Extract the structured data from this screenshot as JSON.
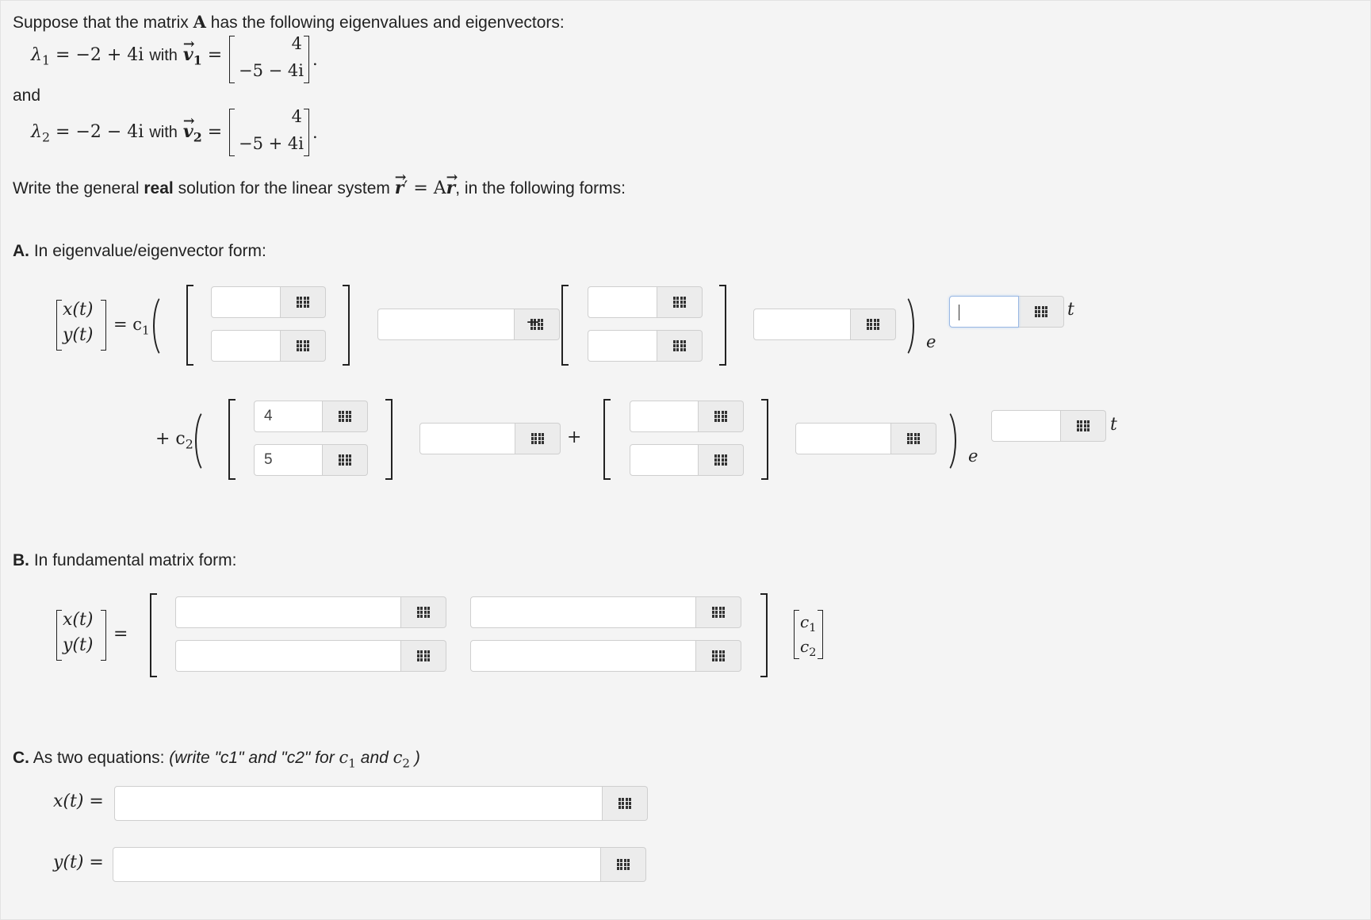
{
  "intro": {
    "line1": "Suppose that the matrix",
    "line1_sym": "A",
    "line1_rest": "has the following eigenvalues and eigenvectors:",
    "and": "and"
  },
  "eig1": {
    "lambda": "λ",
    "sub": "1",
    "value": "= −2 + 4i",
    "with": "with",
    "vec": "v",
    "eq": "=",
    "top": "4",
    "bottom": "−5 − 4i",
    "dot": "."
  },
  "eig2": {
    "lambda": "λ",
    "sub": "2",
    "value": "= −2 − 4i",
    "with": "with",
    "vec": "v",
    "eq": "=",
    "top": "4",
    "bottom": "−5 + 4i",
    "dot": "."
  },
  "instruction": {
    "pre": "Write the general",
    "bold": "real",
    "mid": "solution for the linear system",
    "eq": "′ = A",
    "r": "r",
    "post": ", in the following forms:"
  },
  "partA": {
    "label": "A.",
    "title": "In eigenvalue/eigenvector form:",
    "xt": "x(t)",
    "yt": "y(t)",
    "eq_c1": "= c",
    "c1_sub": "1",
    "plus_c2": "+ c",
    "c2_sub": "2",
    "minus": "−",
    "plus": "+",
    "e": "e",
    "t": "t",
    "row2_top_value": "4",
    "row2_bottom_value": "5"
  },
  "partB": {
    "label": "B.",
    "title": "In fundamental matrix form:",
    "xt": "x(t)",
    "yt": "y(t)",
    "eq": "=",
    "c": "c",
    "c1_sub": "1",
    "c2_sub": "2"
  },
  "partC": {
    "label": "C.",
    "title": "As two equations:",
    "hint_pre": "(write \"c1\" and \"c2\" for",
    "hint_c": "c",
    "hint_and": "and",
    "hint_post": ")",
    "x_label": "x(t) =",
    "y_label": "y(t) ="
  },
  "icons": {
    "matrix_button": "grid-icon"
  }
}
